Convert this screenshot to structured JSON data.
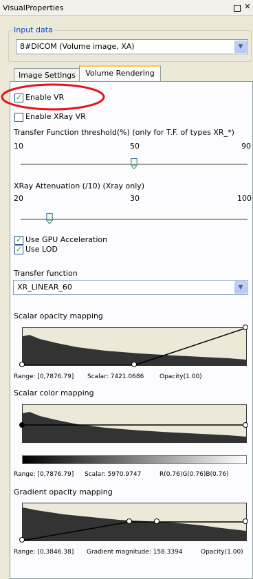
{
  "window": {
    "title": "VisualProperties",
    "restore_icon": "restore-icon",
    "close_icon": "close-icon"
  },
  "input_data": {
    "legend": "Input data",
    "selected": "8#DICOM (Volume image, XA)"
  },
  "tabs": [
    {
      "label": "Image Settings"
    },
    {
      "label": "Volume Rendering"
    }
  ],
  "vr": {
    "enable_vr": {
      "label": "Enable VR",
      "checked": true
    },
    "enable_xray_vr": {
      "label": "Enable XRay VR",
      "checked": false
    },
    "transfer_threshold": {
      "label": "Transfer Function threshold(%) (only for T.F. of types XR_*)",
      "min": "10",
      "mid": "50",
      "max": "90",
      "value": 50
    },
    "xray_attenuation": {
      "label": "XRay Attenuation (/10) (Xray only)",
      "min": "20",
      "mid": "30",
      "max": "100",
      "value": 20
    },
    "use_gpu": {
      "label": "Use GPU Acceleration",
      "checked": true
    },
    "use_lod": {
      "label": "Use LOD",
      "checked": true
    }
  },
  "transfer_function": {
    "label": "Transfer function",
    "selected": "XR_LINEAR_60"
  },
  "scalar_opacity": {
    "label": "Scalar opacity mapping",
    "range": "Range: [0,7876.79]",
    "scalar": "Scalar: 7421.0686",
    "opacity": "Opacity(1.00)"
  },
  "scalar_color": {
    "label": "Scalar color mapping",
    "range": "Range: [0,7876.79]",
    "scalar": "Scalar: 5970.9747",
    "rgb": "R(0.76)G(0.76)B(0.76)"
  },
  "gradient_opacity": {
    "label": "Gradient opacity mapping",
    "range": "Range: [0,3846.38]",
    "magnitude": "Gradient magnitude: 158.3394",
    "opacity": "Opacity(1.00)"
  },
  "colors": {
    "annotation_circle": "#e3151a",
    "accent": "#ffc83c"
  }
}
